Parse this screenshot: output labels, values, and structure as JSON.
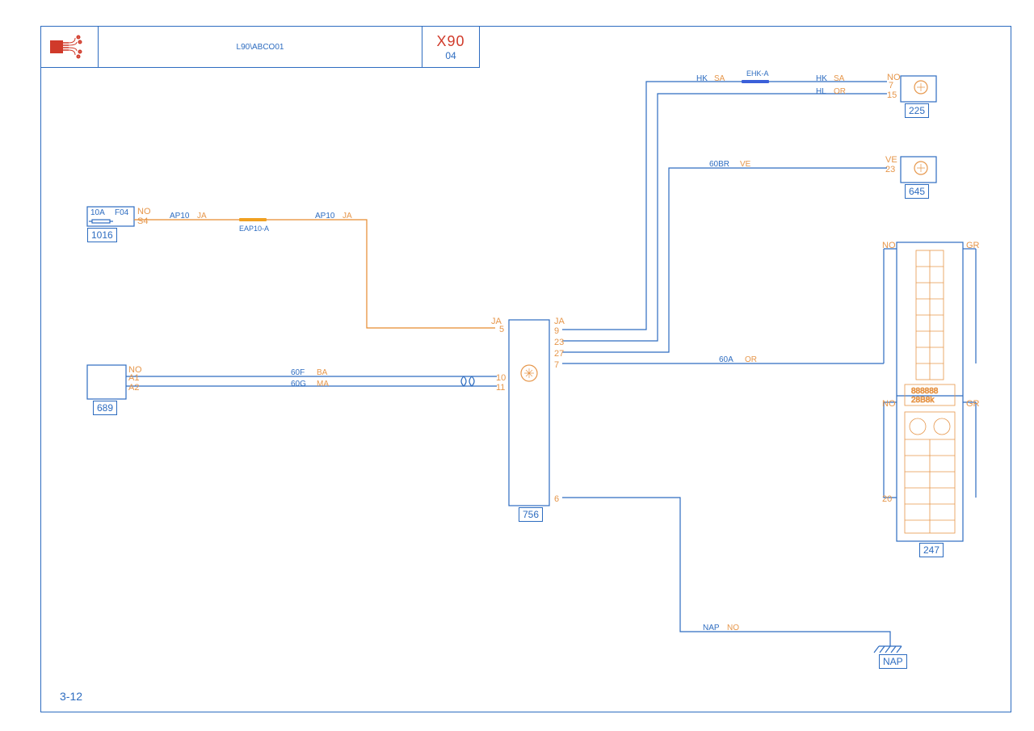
{
  "header": {
    "drawing_name": "L90\\ABCO01",
    "model_code": "X90",
    "page_code": "04"
  },
  "page_number": "3-12",
  "components": {
    "c1016": {
      "id": "1016",
      "fuse_rating": "10A",
      "fuse_slot": "F04",
      "connector": "NO",
      "pin": "S4"
    },
    "c689": {
      "id": "689",
      "connector": "NO",
      "pins": [
        "A1",
        "A2"
      ]
    },
    "c756": {
      "id": "756",
      "left_conn": "JA",
      "left_pins": [
        "5",
        "10",
        "11"
      ],
      "right_conn": "JA",
      "right_pins": [
        "9",
        "23",
        "27",
        "7",
        "6"
      ]
    },
    "c225": {
      "id": "225",
      "connector": "NO",
      "pins": [
        "7",
        "15"
      ]
    },
    "c645": {
      "id": "645",
      "connector": "",
      "pin": "23",
      "signal": "VE"
    },
    "c247": {
      "id": "247",
      "top_conn_l": "NO",
      "top_conn_r": "GR",
      "bot_conn_l": "NO",
      "bot_conn_r": "GR",
      "pin": "20"
    },
    "ground": {
      "id": "NAP"
    }
  },
  "wires": {
    "w_ap10_1": {
      "signal": "AP10",
      "color": "JA"
    },
    "w_ap10_2": {
      "signal": "AP10",
      "color": "JA"
    },
    "w_60f": {
      "signal": "60F",
      "color": "BA"
    },
    "w_60g": {
      "signal": "60G",
      "color": "MA"
    },
    "w_60a": {
      "signal": "60A",
      "color": "OR"
    },
    "w_hk_1": {
      "signal": "HK",
      "color": "SA"
    },
    "w_hk_2": {
      "signal": "HK",
      "color": "SA"
    },
    "w_hl": {
      "signal": "HL",
      "color": "OR"
    },
    "w_60br": {
      "signal": "60BR",
      "color": "VE"
    },
    "w_nap": {
      "signal": "NAP",
      "color": "NO"
    }
  },
  "splices": {
    "eap10": "EAP10-A",
    "ehk": "EHK-A"
  }
}
